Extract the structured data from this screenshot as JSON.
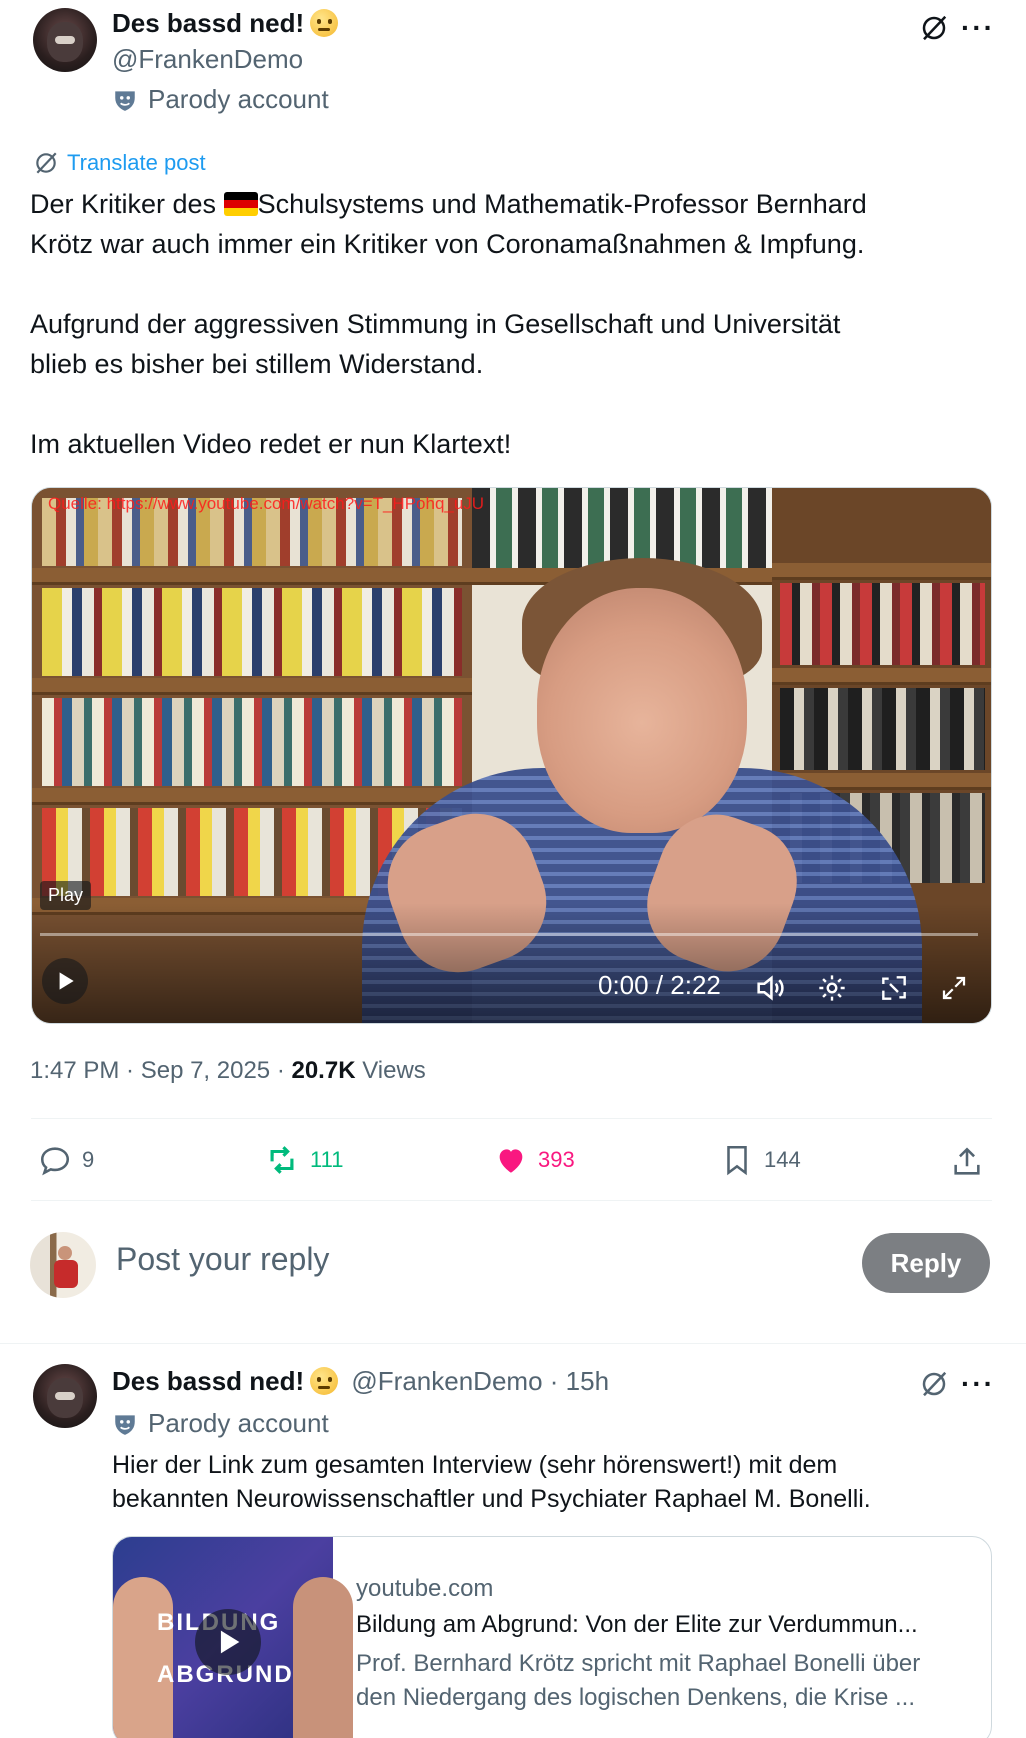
{
  "post": {
    "author_name": "Des bassd ned!",
    "author_handle": "@FrankenDemo",
    "parody_label": "Parody account",
    "translate_label": "Translate post",
    "text_line1a": "Der Kritiker des ",
    "text_line1b": "Schulsystems und Mathematik-Professor Bernhard",
    "text_line2": "Krötz war auch immer ein Kritiker von Coronamaßnahmen & Impfung.",
    "text_line3": "Aufgrund der aggressiven Stimmung in Gesellschaft und Universität",
    "text_line4": "blieb es bisher bei stillem Widerstand.",
    "text_line5": "Im aktuellen Video redet er nun Klartext!",
    "video": {
      "source_overlay": "Quelle: https://www.youtube.com/watch?v=T_HPohq_uJU",
      "play_tooltip": "Play",
      "time_display": "0:00 / 2:22",
      "progress": 0
    },
    "meta_time": "1:47 PM · Sep 7, 2025 · ",
    "views_count": "20.7K",
    "views_label": " Views",
    "stats": {
      "replies": "9",
      "reposts": "111",
      "likes": "393",
      "bookmarks": "144"
    }
  },
  "reply_box": {
    "placeholder": "Post your reply",
    "button_label": "Reply"
  },
  "reply": {
    "author_name": "Des bassd ned!",
    "author_handle": "@FrankenDemo",
    "time": " · 15h",
    "parody_label": "Parody account",
    "text_line1": "Hier der Link zum gesamten Interview (sehr hörenswert!) mit dem",
    "text_line2": "bekannten Neurowissenschaftler und Psychiater Raphael M. Bonelli.",
    "card": {
      "domain": "youtube.com",
      "title": "Bildung am Abgrund: Von der Elite zur Verdummun...",
      "desc_line1": "Prof. Bernhard Krötz spricht mit Raphael Bonelli über",
      "desc_line2": "den Niedergang des logischen Denkens, die Krise ...",
      "thumb_text1": "BILDUNG",
      "thumb_text2": "ABGRUND"
    }
  },
  "colors": {
    "accent": "#1d9bf0",
    "repost": "#00ba7c",
    "like": "#f91880",
    "muted": "#536471"
  }
}
